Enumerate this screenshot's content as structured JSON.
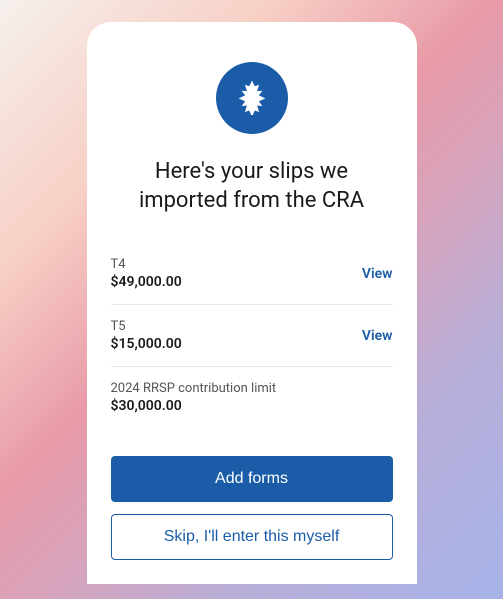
{
  "icon": "maple-leaf-icon",
  "heading": "Here's your slips we imported from the CRA",
  "slips": [
    {
      "label": "T4",
      "amount": "$49,000.00",
      "action": "View",
      "viewable": true
    },
    {
      "label": "T5",
      "amount": "$15,000.00",
      "action": "View",
      "viewable": true
    },
    {
      "label": "2024 RRSP contribution limit",
      "amount": "$30,000.00",
      "action": "",
      "viewable": false
    }
  ],
  "buttons": {
    "primary": "Add forms",
    "secondary": "Skip, I'll enter this myself"
  },
  "colors": {
    "accent": "#1a5ca8"
  }
}
